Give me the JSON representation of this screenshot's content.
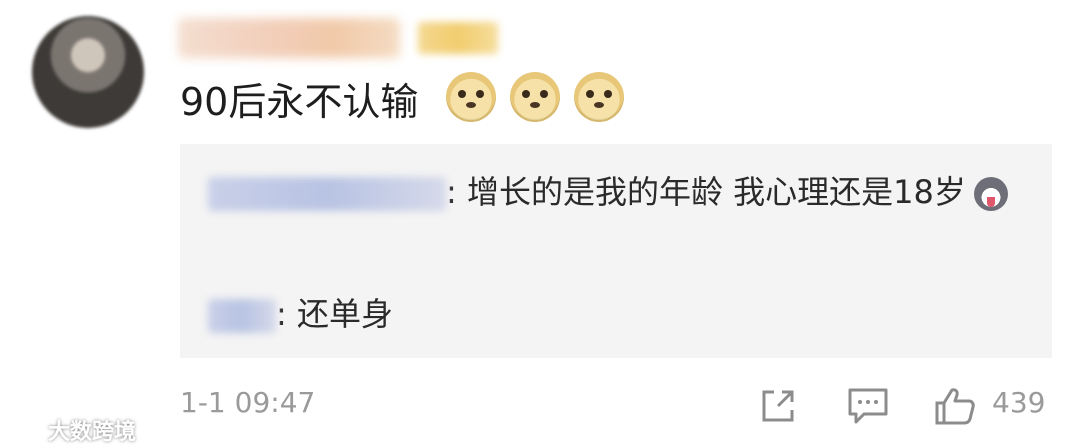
{
  "comment": {
    "text": "90后永不认输",
    "emojis": [
      "doge-icon",
      "doge-icon",
      "doge-icon"
    ],
    "timestamp": "1-1 09:47",
    "like_count": "439"
  },
  "replies": [
    {
      "text": ": 增长的是我的年龄 我心理还是18岁",
      "emoji": "husky-icon"
    },
    {
      "text": ": 还单身"
    }
  ],
  "watermark": {
    "text": "大数跨境"
  },
  "colors": {
    "reply_bg": "#f4f4f4",
    "meta_gray": "#9a9a9a",
    "text": "#1e1e1e"
  }
}
